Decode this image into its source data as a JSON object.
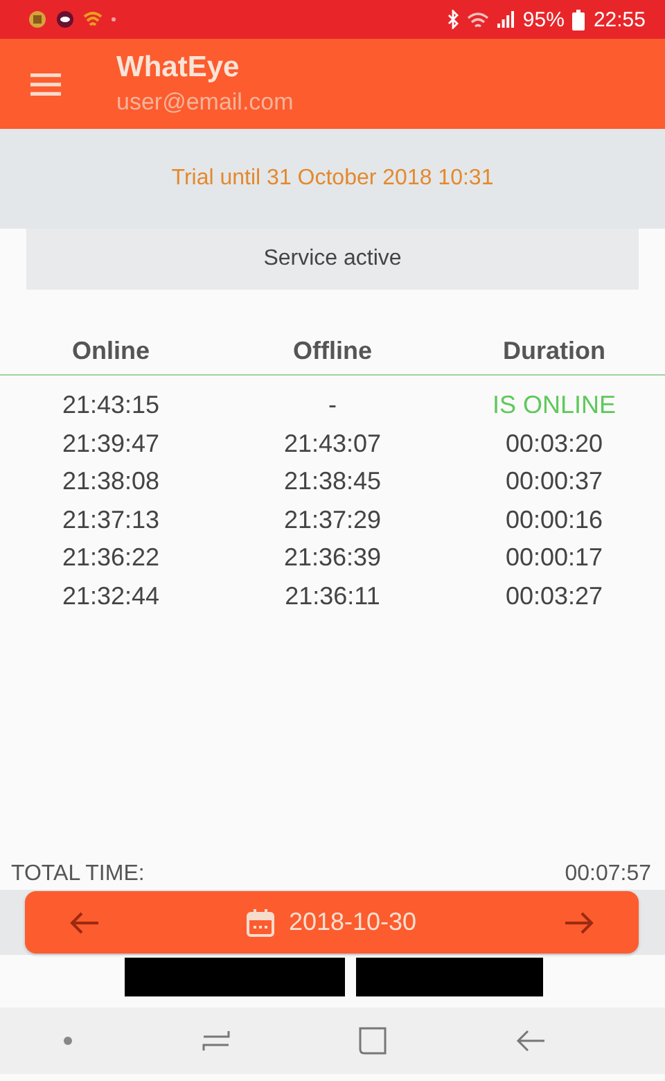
{
  "status_bar": {
    "battery": "95%",
    "time": "22:55"
  },
  "app_bar": {
    "title": "WhatEye",
    "subtitle": "user@email.com"
  },
  "trial_notice": "Trial until 31 October 2018 10:31",
  "service_status": "Service active",
  "table": {
    "columns": [
      "Online",
      "Offline",
      "Duration"
    ],
    "rows": [
      {
        "kind": "online",
        "online": "21:43:15",
        "offline": "-",
        "duration": "IS ONLINE"
      },
      {
        "kind": "session",
        "online": "21:39:47",
        "offline": "21:43:07",
        "duration": "00:03:20"
      },
      {
        "kind": "session",
        "online": "21:38:08",
        "offline": "21:38:45",
        "duration": "00:00:37"
      },
      {
        "kind": "session",
        "online": "21:37:13",
        "offline": "21:37:29",
        "duration": "00:00:16"
      },
      {
        "kind": "session",
        "online": "21:36:22",
        "offline": "21:36:39",
        "duration": "00:00:17"
      },
      {
        "kind": "session",
        "online": "21:32:44",
        "offline": "21:36:11",
        "duration": "00:03:27"
      }
    ]
  },
  "total": {
    "label": "TOTAL TIME:",
    "value": "00:07:57"
  },
  "date_bar": {
    "date": "2018-10-30"
  }
}
